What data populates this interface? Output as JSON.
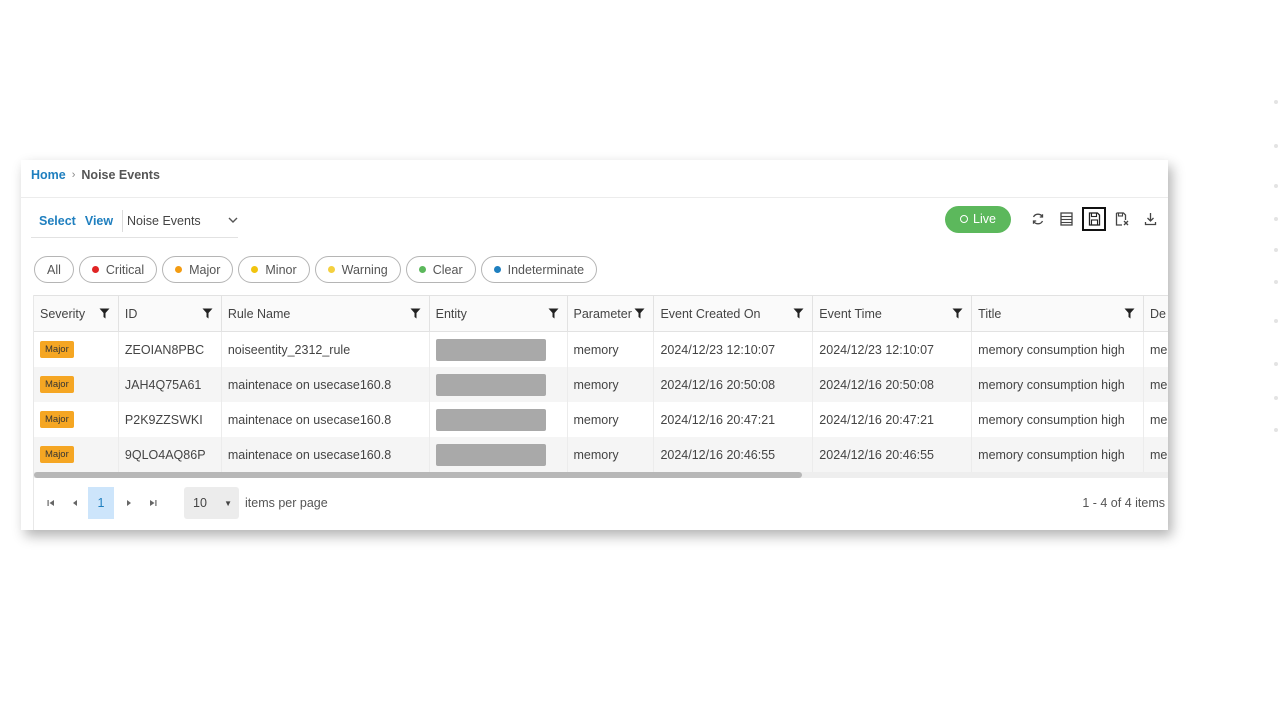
{
  "breadcrumb": {
    "home": "Home",
    "separator": "›",
    "current": "Noise Events"
  },
  "view_selector": {
    "select_label": "Select",
    "view_label": "View",
    "value": "Noise Events"
  },
  "toolbar": {
    "live_label": "Live",
    "icons": [
      "refresh-icon",
      "columns-icon",
      "save-view-icon",
      "saved-views-icon",
      "download-icon"
    ],
    "live_color": "#5cb85c"
  },
  "severity_filters": [
    {
      "label": "All",
      "color": ""
    },
    {
      "label": "Critical",
      "color": "#e02424"
    },
    {
      "label": "Major",
      "color": "#f39c12"
    },
    {
      "label": "Minor",
      "color": "#f1c40f"
    },
    {
      "label": "Warning",
      "color": "#f4d03f"
    },
    {
      "label": "Clear",
      "color": "#5cb85c"
    },
    {
      "label": "Indeterminate",
      "color": "#1f7fbf"
    }
  ],
  "table": {
    "columns": [
      {
        "key": "severity",
        "label": "Severity",
        "filter": true
      },
      {
        "key": "id",
        "label": "ID",
        "filter": true
      },
      {
        "key": "rule_name",
        "label": "Rule Name",
        "filter": true
      },
      {
        "key": "entity",
        "label": "Entity",
        "filter": true
      },
      {
        "key": "parameter",
        "label": "Parameter",
        "filter": true
      },
      {
        "key": "event_created_on",
        "label": "Event Created On",
        "filter": true
      },
      {
        "key": "event_time",
        "label": "Event Time",
        "filter": true
      },
      {
        "key": "title",
        "label": "Title",
        "filter": true
      },
      {
        "key": "description",
        "label": "De",
        "filter": false
      }
    ],
    "rows": [
      {
        "severity": "Major",
        "id": "ZEOIAN8PBC",
        "rule_name": "noiseentity_2312_rule",
        "entity": "",
        "parameter": "memory",
        "event_created_on": "2024/12/23 12:10:07",
        "event_time": "2024/12/23 12:10:07",
        "title": "memory consumption high",
        "description": "me"
      },
      {
        "severity": "Major",
        "id": "JAH4Q75A61",
        "rule_name": "maintenace on usecase160.8",
        "entity": "",
        "parameter": "memory",
        "event_created_on": "2024/12/16 20:50:08",
        "event_time": "2024/12/16 20:50:08",
        "title": "memory consumption high",
        "description": "me"
      },
      {
        "severity": "Major",
        "id": "P2K9ZZSWKI",
        "rule_name": "maintenace on usecase160.8",
        "entity": "",
        "parameter": "memory",
        "event_created_on": "2024/12/16 20:47:21",
        "event_time": "2024/12/16 20:47:21",
        "title": "memory consumption high",
        "description": "me"
      },
      {
        "severity": "Major",
        "id": "9QLO4AQ86P",
        "rule_name": "maintenace on usecase160.8",
        "entity": "",
        "parameter": "memory",
        "event_created_on": "2024/12/16 20:46:55",
        "event_time": "2024/12/16 20:46:55",
        "title": "memory consumption high",
        "description": "me"
      }
    ],
    "severity_badge_color": "#f5a623"
  },
  "pagination": {
    "current_page": "1",
    "page_size": "10",
    "items_per_page_label": "items per page",
    "summary": "1 - 4 of 4 items"
  }
}
